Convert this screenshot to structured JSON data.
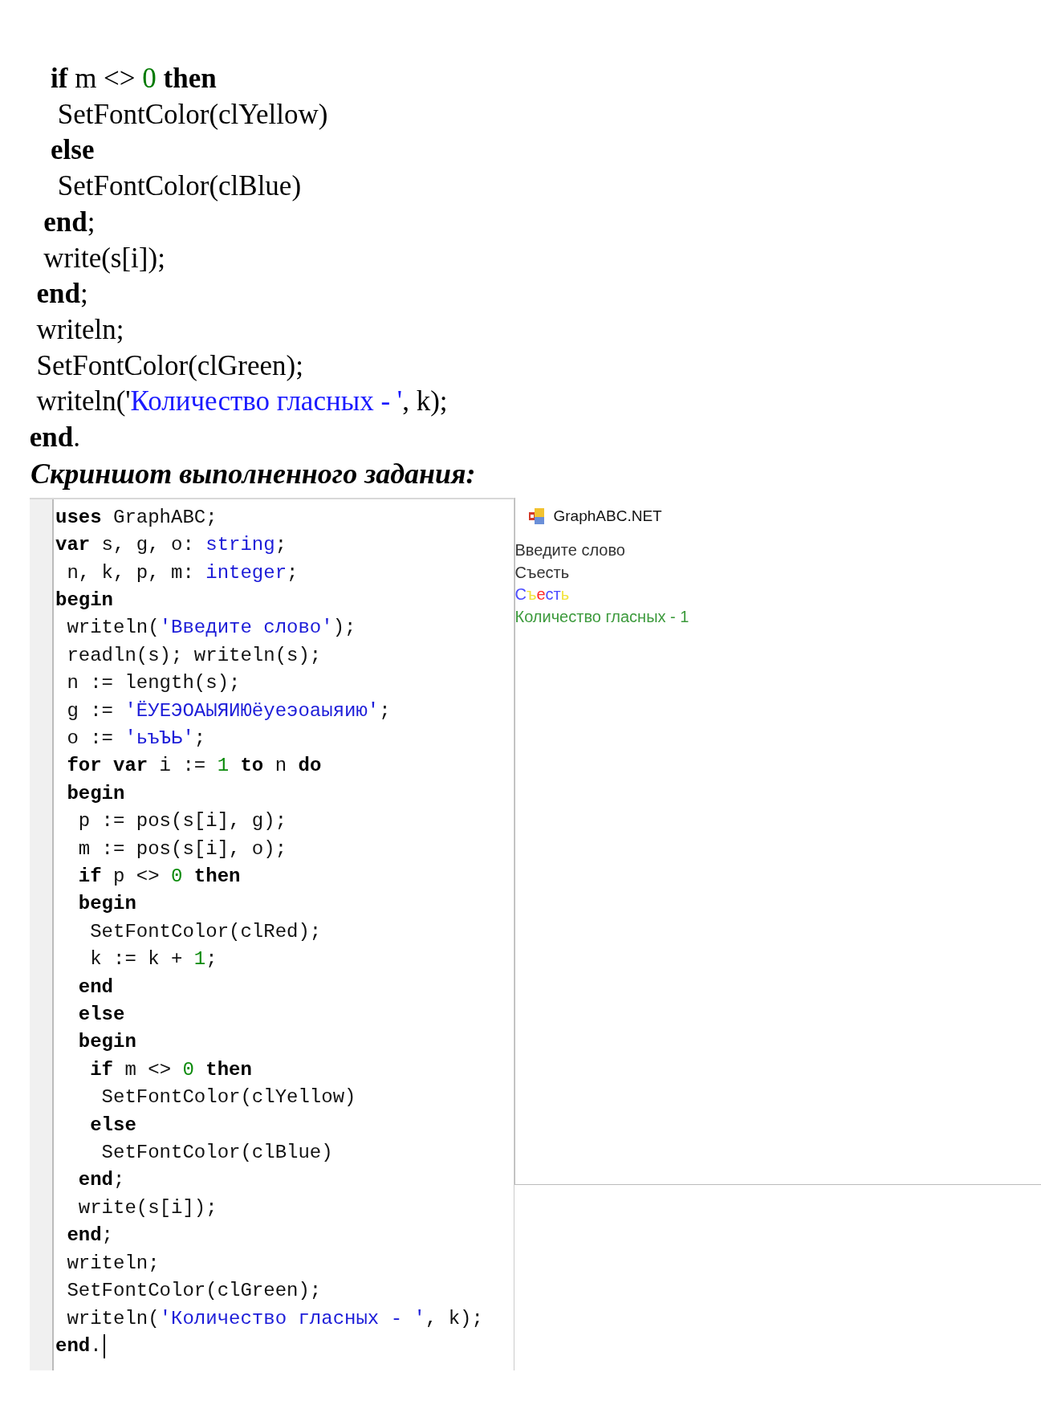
{
  "listing": {
    "lines": [
      [
        {
          "text": "    if",
          "kind": "kw"
        },
        {
          "text": " m <> ",
          "kind": "plain"
        },
        {
          "text": "0",
          "kind": "num"
        },
        {
          "text": " then",
          "kind": "kw"
        }
      ],
      [
        {
          "text": "     SetFontColor(clYellow)",
          "kind": "plain"
        }
      ],
      [
        {
          "text": "    else",
          "kind": "kw"
        }
      ],
      [
        {
          "text": "     SetFontColor(clBlue)",
          "kind": "plain"
        }
      ],
      [
        {
          "text": "   end",
          "kind": "kw"
        },
        {
          "text": ";",
          "kind": "plain"
        }
      ],
      [
        {
          "text": "   write(s[i]);",
          "kind": "plain"
        }
      ],
      [
        {
          "text": "  end",
          "kind": "kw"
        },
        {
          "text": ";",
          "kind": "plain"
        }
      ],
      [
        {
          "text": "  writeln;",
          "kind": "plain"
        }
      ],
      [
        {
          "text": "  SetFontColor(clGreen);",
          "kind": "plain"
        }
      ],
      [
        {
          "text": "  writeln('",
          "kind": "plain"
        },
        {
          "text": "Количество гласных - '",
          "kind": "str"
        },
        {
          "text": ", k);",
          "kind": "plain"
        }
      ],
      [
        {
          "text": " end",
          "kind": "kw"
        },
        {
          "text": ".",
          "kind": "plain"
        }
      ]
    ]
  },
  "heading": "Скриншот выполненного задания:",
  "editor": {
    "lines": [
      [
        {
          "text": "uses",
          "kind": "kw"
        },
        {
          "text": " GraphABC;",
          "kind": "plain"
        }
      ],
      [
        {
          "text": "var",
          "kind": "kw"
        },
        {
          "text": " s, g, o: ",
          "kind": "plain"
        },
        {
          "text": "string",
          "kind": "type"
        },
        {
          "text": ";",
          "kind": "plain"
        }
      ],
      [
        {
          "text": " n, k, p, m: ",
          "kind": "plain"
        },
        {
          "text": "integer",
          "kind": "type"
        },
        {
          "text": ";",
          "kind": "plain"
        }
      ],
      [
        {
          "text": "begin",
          "kind": "kw"
        }
      ],
      [
        {
          "text": " writeln(",
          "kind": "plain"
        },
        {
          "text": "'Введите слово'",
          "kind": "str"
        },
        {
          "text": ");",
          "kind": "plain"
        }
      ],
      [
        {
          "text": " readln(s); writeln(s);",
          "kind": "plain"
        }
      ],
      [
        {
          "text": " n := length(s);",
          "kind": "plain"
        }
      ],
      [
        {
          "text": " g := ",
          "kind": "plain"
        },
        {
          "text": "'ЁУЕЭОАЫЯИЮёуеэоаыяию'",
          "kind": "str"
        },
        {
          "text": ";",
          "kind": "plain"
        }
      ],
      [
        {
          "text": " o := ",
          "kind": "plain"
        },
        {
          "text": "'ьъЪЬ'",
          "kind": "str"
        },
        {
          "text": ";",
          "kind": "plain"
        }
      ],
      [
        {
          "text": " for var",
          "kind": "kw"
        },
        {
          "text": " i := ",
          "kind": "plain"
        },
        {
          "text": "1",
          "kind": "num"
        },
        {
          "text": " to",
          "kind": "kw"
        },
        {
          "text": " n",
          "kind": "plain"
        },
        {
          "text": " do",
          "kind": "kw"
        }
      ],
      [
        {
          "text": " begin",
          "kind": "kw"
        }
      ],
      [
        {
          "text": "  p := pos(s[i], g);",
          "kind": "plain"
        }
      ],
      [
        {
          "text": "  m := pos(s[i], o);",
          "kind": "plain"
        }
      ],
      [
        {
          "text": "  if",
          "kind": "kw"
        },
        {
          "text": " p <> ",
          "kind": "plain"
        },
        {
          "text": "0",
          "kind": "num"
        },
        {
          "text": " then",
          "kind": "kw"
        }
      ],
      [
        {
          "text": "  begin",
          "kind": "kw"
        }
      ],
      [
        {
          "text": "   SetFontColor(clRed);",
          "kind": "plain"
        }
      ],
      [
        {
          "text": "   k := k + ",
          "kind": "plain"
        },
        {
          "text": "1",
          "kind": "num"
        },
        {
          "text": ";",
          "kind": "plain"
        }
      ],
      [
        {
          "text": "  end",
          "kind": "kw"
        }
      ],
      [
        {
          "text": "  else",
          "kind": "kw"
        }
      ],
      [
        {
          "text": "  begin",
          "kind": "kw"
        }
      ],
      [
        {
          "text": "   if",
          "kind": "kw"
        },
        {
          "text": " m <> ",
          "kind": "plain"
        },
        {
          "text": "0",
          "kind": "num"
        },
        {
          "text": " then",
          "kind": "kw"
        }
      ],
      [
        {
          "text": "    SetFontColor(clYellow)",
          "kind": "plain"
        }
      ],
      [
        {
          "text": "   else",
          "kind": "kw"
        }
      ],
      [
        {
          "text": "    SetFontColor(clBlue)",
          "kind": "plain"
        }
      ],
      [
        {
          "text": "  end",
          "kind": "kw"
        },
        {
          "text": ";",
          "kind": "plain"
        }
      ],
      [
        {
          "text": "  write(s[i]);",
          "kind": "plain"
        }
      ],
      [
        {
          "text": " end",
          "kind": "kw"
        },
        {
          "text": ";",
          "kind": "plain"
        }
      ],
      [
        {
          "text": " writeln;",
          "kind": "plain"
        }
      ],
      [
        {
          "text": " SetFontColor(clGreen);",
          "kind": "plain"
        }
      ],
      [
        {
          "text": " writeln(",
          "kind": "plain"
        },
        {
          "text": "'Количество гласных - '",
          "kind": "str"
        },
        {
          "text": ", k);",
          "kind": "plain"
        }
      ],
      [
        {
          "text": "end",
          "kind": "kw"
        },
        {
          "text": ".",
          "kind": "plain"
        }
      ]
    ]
  },
  "output_window": {
    "title": "GraphABC.NET",
    "lines": [
      {
        "segments": [
          {
            "text": "Введите слово",
            "color": "#333333"
          }
        ]
      },
      {
        "segments": [
          {
            "text": "Съесть",
            "color": "#333333"
          }
        ]
      },
      {
        "segments": [
          {
            "text": "С",
            "color": "#4a4aff"
          },
          {
            "text": "ъ",
            "color": "#f2e33a"
          },
          {
            "text": "е",
            "color": "#ff2a2a"
          },
          {
            "text": "с",
            "color": "#4a4aff"
          },
          {
            "text": "т",
            "color": "#4a4aff"
          },
          {
            "text": "ь",
            "color": "#f2e33a"
          }
        ]
      },
      {
        "segments": [
          {
            "text": "Количество гласных - 1",
            "color": "#3c9a3c"
          }
        ]
      }
    ]
  }
}
